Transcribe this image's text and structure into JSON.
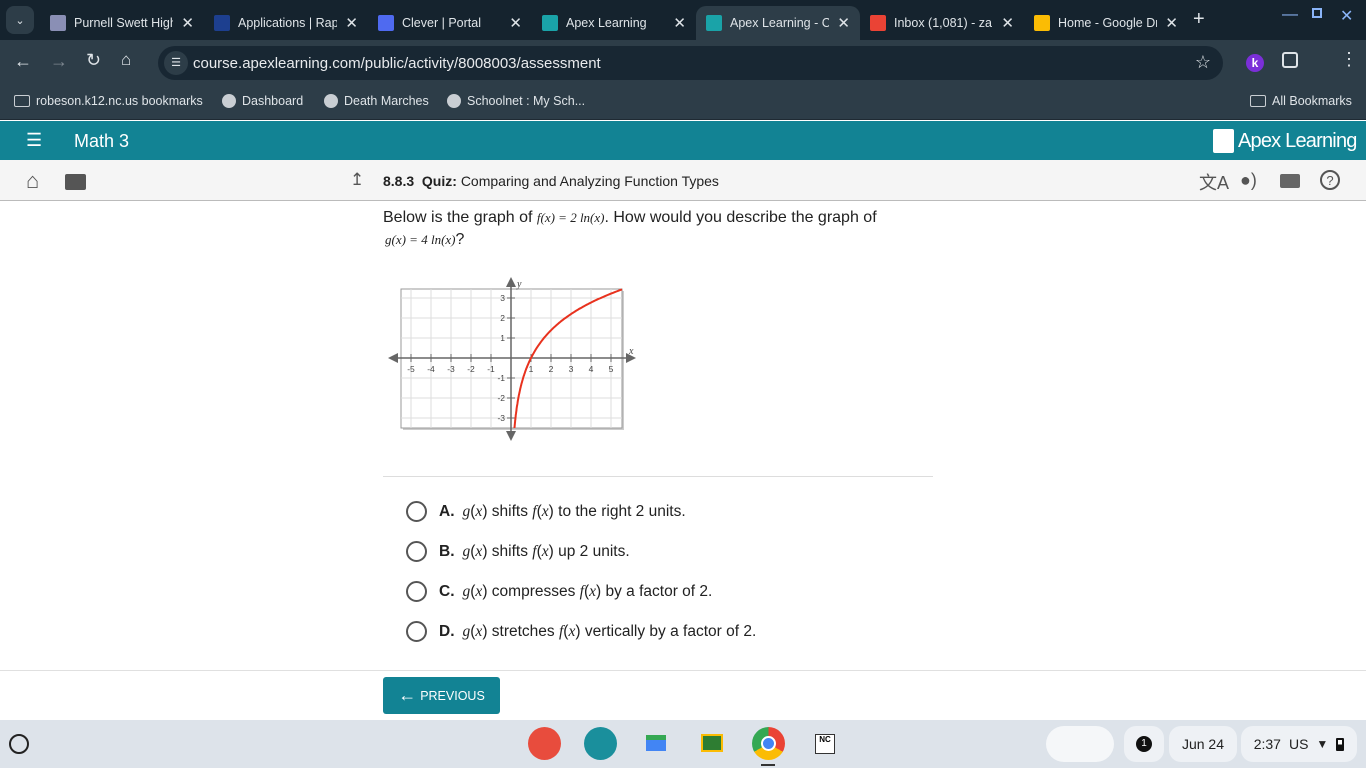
{
  "browser": {
    "tabs": [
      {
        "label": "Purnell Swett High",
        "icon": "shield-icon",
        "color": "#8a8fb5",
        "active": false
      },
      {
        "label": "Applications | Rapid",
        "icon": "nc-icon",
        "color": "#1d3f8f",
        "active": false
      },
      {
        "label": "Clever | Portal",
        "icon": "clever-icon",
        "color": "#4f6af0",
        "active": false
      },
      {
        "label": "Apex Learning",
        "icon": "apex-icon",
        "color": "#1aa3a8",
        "active": false
      },
      {
        "label": "Apex Learning - Courses",
        "icon": "apex-icon",
        "color": "#1aa3a8",
        "active": true
      },
      {
        "label": "Inbox (1,081) - za",
        "icon": "gmail-icon",
        "color": "#ea4335",
        "active": false
      },
      {
        "label": "Home - Google Drive",
        "icon": "drive-icon",
        "color": "#fbbc04",
        "active": false
      }
    ],
    "url": "course.apexlearning.com/public/activity/8008003/assessment",
    "profile_initial": "k",
    "bookmarks": [
      "robeson.k12.nc.us bookmarks",
      "Dashboard",
      "Death Marches",
      "Schoolnet : My Sch..."
    ],
    "all_bookmarks": "All Bookmarks"
  },
  "app": {
    "course": "Math 3",
    "brand": "Apex Learning",
    "brand_color": "#128394",
    "quiz_number": "8.8.3",
    "quiz_label": "Quiz:",
    "quiz_title": "Comparing and Analyzing Function Types"
  },
  "question": {
    "text_before": "Below is the graph of ",
    "f_expr": "f(x) = 2 ln(x)",
    "text_after": ". How would you describe the graph of",
    "g_expr": "g(x) = 4 ln(x)",
    "qmark": "?"
  },
  "chart_data": {
    "type": "line",
    "function": "f(x) = 2 ln(x)",
    "xlabel": "x",
    "ylabel": "y",
    "xlim": [
      -5.5,
      5.55
    ],
    "ylim": [
      -3.5,
      3.45
    ],
    "xticks": [
      -5,
      -4,
      -3,
      -2,
      -1,
      1,
      2,
      3,
      4,
      5
    ],
    "yticks": [
      -3,
      -2,
      -1,
      1,
      2,
      3
    ],
    "grid": true,
    "line_color": "#e8321e"
  },
  "options": [
    {
      "letter": "A.",
      "g": "g",
      "fx": "f",
      "rest": " to the right 2 units.",
      "verb": " shifts "
    },
    {
      "letter": "B.",
      "g": "g",
      "fx": "f",
      "rest": " up 2 units.",
      "verb": " shifts "
    },
    {
      "letter": "C.",
      "g": "g",
      "fx": "f",
      "rest": " by a factor of 2.",
      "verb": " compresses "
    },
    {
      "letter": "D.",
      "g": "g",
      "fx": "f",
      "rest": " vertically by a factor of 2.",
      "verb": " stretches "
    }
  ],
  "previous_label": "PREVIOUS",
  "shelf": {
    "notifications": "1",
    "date": "Jun 24",
    "time": "2:37",
    "locale": "US"
  }
}
